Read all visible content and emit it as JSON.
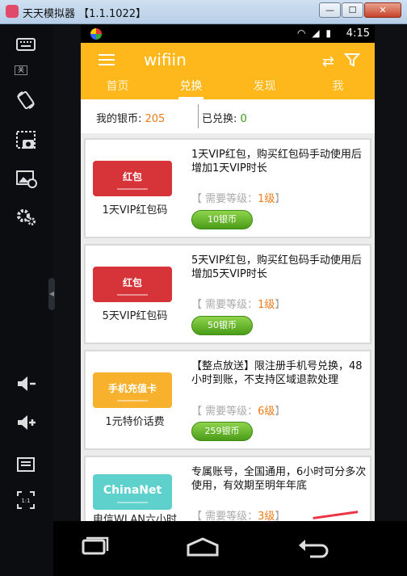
{
  "window": {
    "title": "天天模拟器 【1.1.1022】",
    "minimize_label": "—",
    "maximize_label": "☐",
    "close_label": "✕"
  },
  "sidebar": {
    "keyboard_toggle_label": "关",
    "items": [
      "keyboard-icon",
      "rotate-icon",
      "screenshot-icon",
      "add-image-icon",
      "settings-icon",
      "volume-down-icon",
      "volume-up-icon",
      "menu-icon",
      "scale-icon"
    ],
    "scale_label": "1:1"
  },
  "statusbar": {
    "time": "4:15",
    "icons": [
      "wifi-icon",
      "signal-icon",
      "battery-icon"
    ]
  },
  "appbar": {
    "title": "wifiin",
    "tabs": [
      {
        "label": "首页",
        "active": false
      },
      {
        "label": "兑换",
        "active": true
      },
      {
        "label": "发现",
        "active": false
      },
      {
        "label": "我",
        "active": false
      }
    ],
    "accent_color": "#ffb81c"
  },
  "balance": {
    "silver_label": "我的银币: ",
    "silver_value": "205",
    "redeemed_label": "已兑换: ",
    "redeemed_value": "0"
  },
  "items": [
    {
      "voucher_text": "红包",
      "name": "1天VIP红包码",
      "desc": "1天VIP红包，购买红包码手动使用后增加1天VIP时长",
      "level_prefix": "【 需要等级：",
      "level_value": "1级",
      "level_suffix": "】",
      "price": "10银币"
    },
    {
      "voucher_text": "红包",
      "name": "5天VIP红包码",
      "desc": "5天VIP红包，购买红包码手动使用后增加5天VIP时长",
      "level_prefix": "【 需要等级：",
      "level_value": "1级",
      "level_suffix": "】",
      "price": "50银币"
    },
    {
      "voucher_text": "手机充值卡",
      "name": "1元特价话费",
      "desc": "【整点放送】限注册手机号兑换，48小时到账，不支持区域退款处理",
      "level_prefix": "【 需要等级：",
      "level_value": "6级",
      "level_suffix": "】",
      "price": "259银币"
    },
    {
      "voucher_text": "ChinaNet",
      "name": "电信WLAN六小时",
      "desc": "专属账号，全国通用，6小时可分多次使用，有效期至明年年底",
      "level_prefix": "【 需要等级：",
      "level_value": "3级",
      "level_suffix": "】",
      "price": ""
    }
  ]
}
